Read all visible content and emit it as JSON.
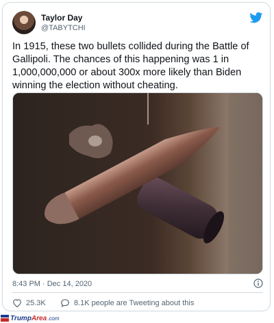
{
  "tweet": {
    "display_name": "Taylor Day",
    "handle": "@TABYTCHI",
    "text": "In 1915, these two bullets collided during the Battle of Gallipoli. The chances of this happening was 1 in 1,000,000,000 or about 300x more likely than Biden winning the election without cheating.",
    "timestamp": "8:43 PM · Dec 14, 2020",
    "likes": "25.3K",
    "people_tweeting": "8.1K people are Tweeting about this"
  },
  "icons": {
    "brand": "twitter-bird-icon",
    "info": "info-icon",
    "like": "heart-icon",
    "people": "speech-bubble-icon",
    "image": "bullets-photo"
  },
  "colors": {
    "twitter_blue": "#1d9bf0",
    "text": "#0f1419",
    "muted": "#536471",
    "border": "#cfd9de"
  },
  "footer": {
    "logo_part1": "Trump",
    "logo_part2": "Area",
    "logo_part3": ".com"
  }
}
